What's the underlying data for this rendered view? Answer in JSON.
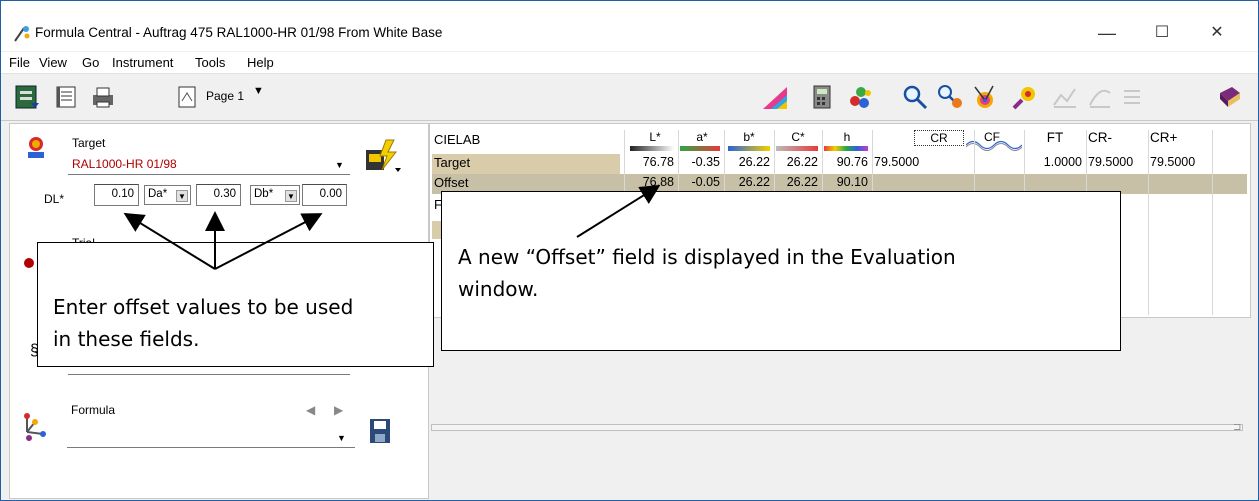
{
  "window": {
    "title": "Formula Central  -  Auftrag 475 RAL1000-HR 01/98 From White Base",
    "minimize": "—",
    "maximize": "☐",
    "close": "✕"
  },
  "menu": [
    "File",
    "View",
    "Go",
    "Instrument",
    "Tools",
    "Help"
  ],
  "toolbar": {
    "page_label": "Page 1",
    "page_dropdown": "▼"
  },
  "target": {
    "label": "Target",
    "value": "RAL1000-HR 01/98",
    "dl_label": "DL*",
    "dl_value": "0.10",
    "da_label": "Da*",
    "da_value": "0.30",
    "db_label": "Db*",
    "db_value": "0.00"
  },
  "trial": {
    "label": "Trial"
  },
  "formula": {
    "label": "Formula",
    "prev": "◀",
    "next": "▶"
  },
  "evaluation": {
    "corner_label": "CIELAB",
    "columns": [
      "L*",
      "a*",
      "b*",
      "C*",
      "h",
      "CR",
      "CF",
      "FT",
      "CR-",
      "CR+"
    ],
    "rows": [
      {
        "label": "Target",
        "values": [
          "76.78",
          "-0.35",
          "26.22",
          "26.22",
          "90.76",
          "79.5000",
          "",
          "1.0000",
          "79.5000",
          "79.5000"
        ]
      },
      {
        "label": "Offset",
        "values": [
          "76.88",
          "-0.05",
          "26.22",
          "26.22",
          "90.10",
          "",
          "",
          "",
          "",
          ""
        ]
      }
    ],
    "partial_row_label": "F"
  },
  "callouts": {
    "left_line1": "Enter offset values to be used",
    "left_line2": "in these fields.",
    "right_line1": "A new “Offset” field is displayed in the Evaluation",
    "right_line2": "window."
  },
  "colors": {
    "target_text": "#b00000",
    "row_band": "#d9ccab",
    "offset_band": "#c8c0a6",
    "window_border": "#1f5fa8"
  }
}
